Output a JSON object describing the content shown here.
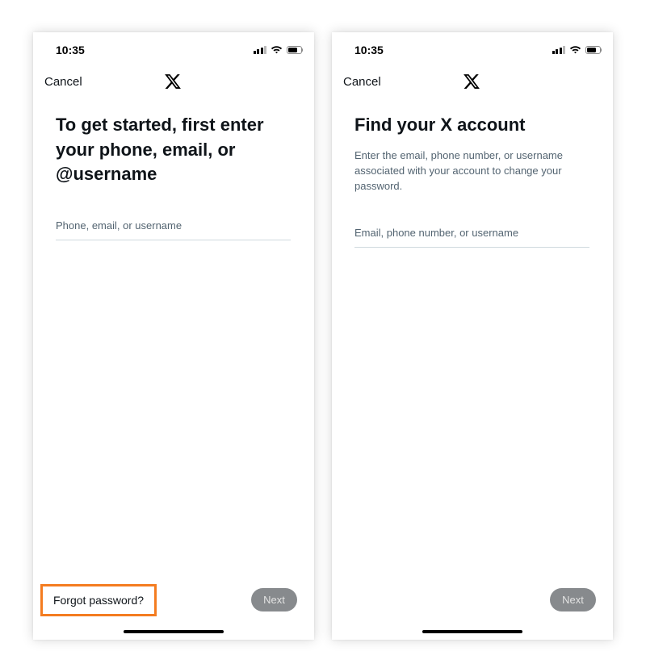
{
  "left_screen": {
    "status_time": "10:35",
    "cancel_label": "Cancel",
    "heading": "To get started, first enter your phone, email, or @username",
    "input_placeholder": "Phone, email, or username",
    "forgot_label": "Forgot password?",
    "next_label": "Next"
  },
  "right_screen": {
    "status_time": "10:35",
    "cancel_label": "Cancel",
    "heading": "Find your X account",
    "description": "Enter the email, phone number, or username associated with your account to change your password.",
    "input_placeholder": "Email, phone number, or username",
    "next_label": "Next"
  },
  "icons": {
    "logo": "x-logo-icon",
    "signal": "cellular-signal-icon",
    "wifi": "wifi-icon",
    "battery": "battery-icon"
  },
  "colors": {
    "highlight": "#f47c20",
    "text_primary": "#0f1419",
    "text_secondary": "#536471",
    "button_disabled": "#878a8d"
  }
}
